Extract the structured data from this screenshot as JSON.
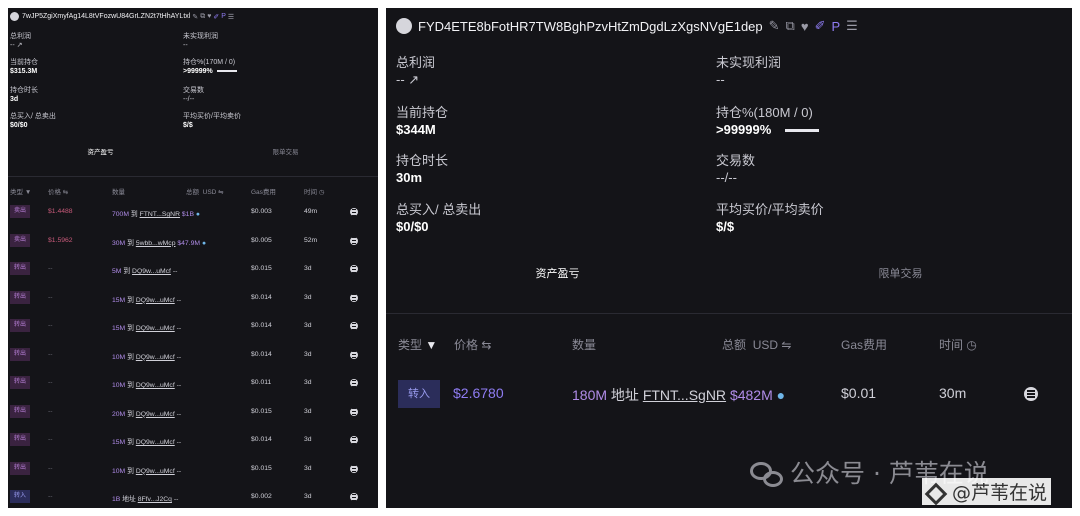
{
  "left": {
    "address": "7wJP5ZgiXmyfAg14L8tVFozwU84GrLZN2t7tHhAYLtxl",
    "stats": {
      "total_profit_label": "总利润",
      "total_profit_value": "--",
      "unrealized_label": "未实现利润",
      "unrealized_value": "--",
      "holding_label": "当前持仓",
      "holding_value": "$315.3M",
      "hold_pct_label": "持仓%(170M / 0)",
      "hold_pct_value": ">99999%",
      "duration_label": "持仓时长",
      "duration_value": "3d",
      "trades_label": "交易数",
      "trades_value": "--/--",
      "buy_sell_label": "总买入/ 总卖出",
      "buy_sell_value": "$0/$0",
      "avg_label": "平均买价/平均卖价",
      "avg_value": "$/$"
    },
    "tabs": [
      "资产盈亏",
      "限单交易"
    ],
    "headers": {
      "type": "类型",
      "price": "价格 ⇆",
      "qty": "数量",
      "total": "总额",
      "usd": "USD",
      "gas": "Gas费用",
      "time": "时间"
    },
    "rows": [
      {
        "type": "卖出",
        "kind": "sell",
        "price": "$1.4488",
        "amount": "700M",
        "arrow": "到",
        "addr": "FTNT...SgNR",
        "total": "$1B",
        "gas": "$0.003",
        "time": "49m"
      },
      {
        "type": "卖出",
        "kind": "sell",
        "price": "$1.5962",
        "amount": "30M",
        "arrow": "到",
        "addr": "5wbb...wMcp",
        "total": "$47.9M",
        "gas": "$0.005",
        "time": "52m"
      },
      {
        "type": "转出",
        "kind": "sell",
        "price": "--",
        "amount": "5M",
        "arrow": "到",
        "addr": "DQ9w...uMcf",
        "total": "--",
        "gas": "$0.015",
        "time": "3d"
      },
      {
        "type": "转出",
        "kind": "sell",
        "price": "--",
        "amount": "15M",
        "arrow": "到",
        "addr": "DQ9w...uMcf",
        "total": "--",
        "gas": "$0.014",
        "time": "3d"
      },
      {
        "type": "转出",
        "kind": "sell",
        "price": "--",
        "amount": "15M",
        "arrow": "到",
        "addr": "DQ9w...uMcf",
        "total": "--",
        "gas": "$0.014",
        "time": "3d"
      },
      {
        "type": "转出",
        "kind": "sell",
        "price": "--",
        "amount": "10M",
        "arrow": "到",
        "addr": "DQ9w...uMcf",
        "total": "--",
        "gas": "$0.014",
        "time": "3d"
      },
      {
        "type": "转出",
        "kind": "sell",
        "price": "--",
        "amount": "10M",
        "arrow": "到",
        "addr": "DQ9w...uMcf",
        "total": "--",
        "gas": "$0.011",
        "time": "3d"
      },
      {
        "type": "转出",
        "kind": "sell",
        "price": "--",
        "amount": "20M",
        "arrow": "到",
        "addr": "DQ9w...uMcf",
        "total": "--",
        "gas": "$0.015",
        "time": "3d"
      },
      {
        "type": "转出",
        "kind": "sell",
        "price": "--",
        "amount": "15M",
        "arrow": "到",
        "addr": "DQ9w...uMcf",
        "total": "--",
        "gas": "$0.014",
        "time": "3d"
      },
      {
        "type": "转出",
        "kind": "sell",
        "price": "--",
        "amount": "10M",
        "arrow": "到",
        "addr": "DQ9w...uMcf",
        "total": "--",
        "gas": "$0.015",
        "time": "3d"
      },
      {
        "type": "转入",
        "kind": "buy",
        "price": "--",
        "amount": "1B",
        "arrow": "地址",
        "addr": "8Ffv...J2Cq",
        "total": "--",
        "gas": "$0.002",
        "time": "3d"
      }
    ]
  },
  "right": {
    "address": "FYD4ETE8bFotHR7TW8BghPzvHtZmDgdLzXgsNVgE1dep",
    "stats": {
      "total_profit_label": "总利润",
      "total_profit_value": "--",
      "unrealized_label": "未实现利润",
      "unrealized_value": "--",
      "holding_label": "当前持仓",
      "holding_value": "$344M",
      "hold_pct_label": "持仓%(180M / 0)",
      "hold_pct_value": ">99999%",
      "duration_label": "持仓时长",
      "duration_value": "30m",
      "trades_label": "交易数",
      "trades_value": "--/--",
      "buy_sell_label": "总买入/ 总卖出",
      "buy_sell_value": "$0/$0",
      "avg_label": "平均买价/平均卖价",
      "avg_value": "$/$"
    },
    "tabs": [
      "资产盈亏",
      "限单交易"
    ],
    "headers": {
      "type": "类型",
      "price": "价格 ⇆",
      "qty": "数量",
      "total": "总额",
      "usd": "USD",
      "gas": "Gas费用",
      "time": "时间"
    },
    "row": {
      "type": "转入",
      "price": "$2.6780",
      "amount": "180M",
      "arrow": "地址",
      "addr": "FTNT...SgNR",
      "total": "$482M",
      "gas": "$0.01",
      "time": "30m"
    }
  },
  "watermark": {
    "main": "公众号 · 芦苇在说",
    "brand": "@芦苇在说"
  },
  "icons": {
    "header": [
      "edit-icon",
      "copy-icon",
      "heart-icon",
      "pen-icon",
      "p-badge-icon",
      "menu-icon"
    ]
  },
  "colors": {
    "panel_bg": "#141418",
    "accent": "#8f7cf2",
    "sell_price": "#c85a7a"
  }
}
